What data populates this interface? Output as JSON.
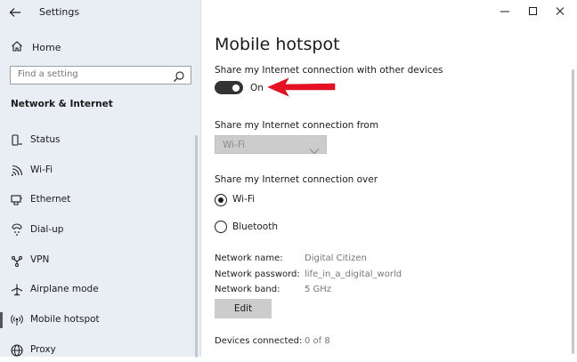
{
  "window": {
    "title": "Settings"
  },
  "sidebar": {
    "home_label": "Home",
    "search_placeholder": "Find a setting",
    "section_title": "Network & Internet",
    "items": [
      {
        "label": "Status",
        "icon": "status-icon"
      },
      {
        "label": "Wi-Fi",
        "icon": "wifi-icon"
      },
      {
        "label": "Ethernet",
        "icon": "ethernet-icon"
      },
      {
        "label": "Dial-up",
        "icon": "dialup-icon"
      },
      {
        "label": "VPN",
        "icon": "vpn-icon"
      },
      {
        "label": "Airplane mode",
        "icon": "airplane-icon"
      },
      {
        "label": "Mobile hotspot",
        "icon": "hotspot-icon",
        "active": true
      },
      {
        "label": "Proxy",
        "icon": "globe-icon"
      }
    ]
  },
  "main": {
    "title": "Mobile hotspot",
    "share_label": "Share my Internet connection with other devices",
    "toggle_state": "On",
    "from_label": "Share my Internet connection from",
    "from_value": "Wi-Fi",
    "over_label": "Share my Internet connection over",
    "over_options": [
      {
        "label": "Wi-Fi",
        "checked": true
      },
      {
        "label": "Bluetooth",
        "checked": false
      }
    ],
    "network_name_label": "Network name:",
    "network_name_value": "Digital Citizen",
    "network_password_label": "Network password:",
    "network_password_value": "life_in_a_digital_world",
    "network_band_label": "Network band:",
    "network_band_value": "5 GHz",
    "edit_label": "Edit",
    "devices_label": "Devices connected:",
    "devices_value": "0 of 8"
  },
  "colors": {
    "sidebar_bg": "#e8eef4",
    "toggle_on": "#333333",
    "annotation_arrow": "#e81123",
    "disabled_control": "#cccccc"
  }
}
